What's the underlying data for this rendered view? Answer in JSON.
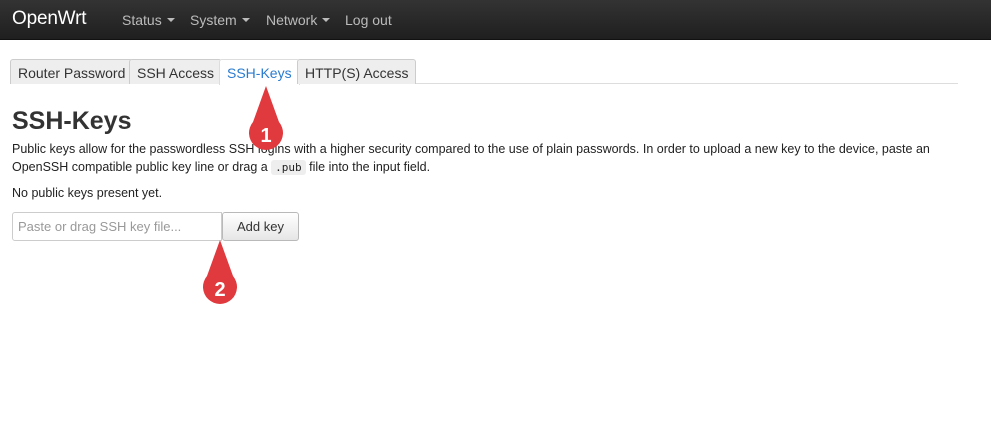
{
  "navbar": {
    "brand": "OpenWrt",
    "items": [
      {
        "label": "Status",
        "has_dropdown": true
      },
      {
        "label": "System",
        "has_dropdown": true
      },
      {
        "label": "Network",
        "has_dropdown": true
      },
      {
        "label": "Log out",
        "has_dropdown": false
      }
    ]
  },
  "tabs": [
    {
      "label": "Router Password",
      "active": false
    },
    {
      "label": "SSH Access",
      "active": false
    },
    {
      "label": "SSH-Keys",
      "active": true
    },
    {
      "label": "HTTP(S) Access",
      "active": false
    }
  ],
  "page": {
    "title": "SSH-Keys",
    "description_part1": "Public keys allow for the passwordless SSH logins with a higher security compared to the use of plain passwords. In order to upload a new key to the device, paste an OpenSSH compatible public key line or drag a ",
    "description_code": ".pub",
    "description_part2": " file into the input field.",
    "status": "No public keys present yet."
  },
  "form": {
    "input_placeholder": "Paste or drag SSH key file...",
    "input_value": "",
    "add_label": "Add key"
  },
  "annotations": {
    "marker_color": "#e0393e",
    "markers": [
      {
        "label": "1"
      },
      {
        "label": "2"
      }
    ]
  },
  "colors": {
    "navbar_bg": "#222222",
    "active_tab_text": "#2a7bd0"
  }
}
